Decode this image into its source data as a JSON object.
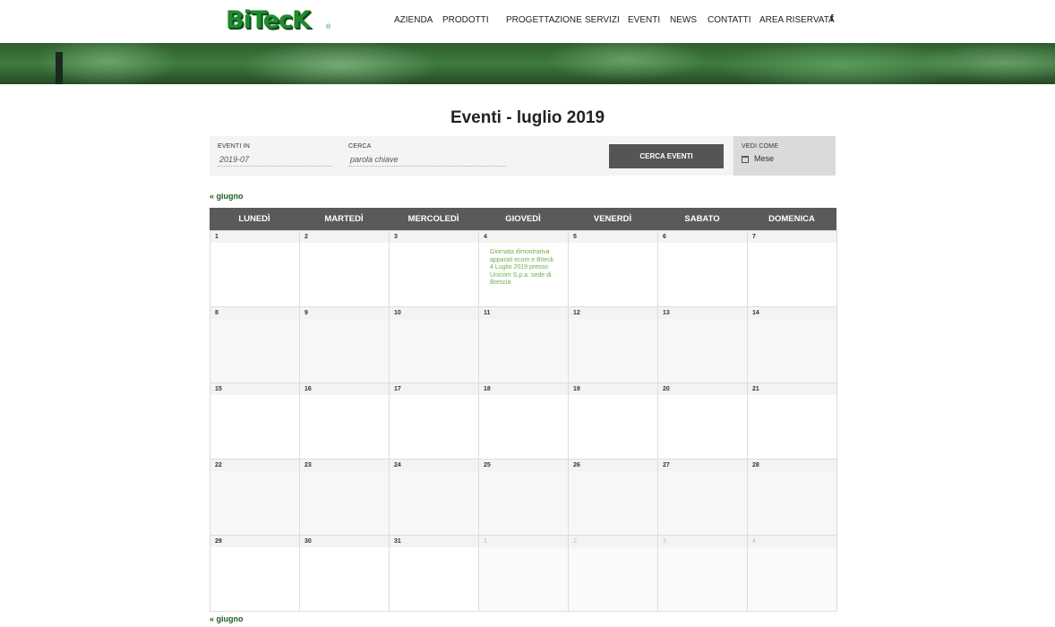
{
  "brand": {
    "logo_text": "BiTecK",
    "logo_reg": "®"
  },
  "nav": {
    "items": [
      "AZIENDA",
      "PRODOTTI",
      "PROGETTAZIONE",
      "SERVIZI",
      "EVENTI",
      "NEWS",
      "CONTATTI",
      "AREA RISERVATA"
    ],
    "social_icon": "facebook-icon"
  },
  "page": {
    "title": "Eventi - luglio 2019"
  },
  "filters": {
    "events_in_label": "EVENTI IN",
    "events_in_value": "2019-07",
    "search_label": "CERCA",
    "search_placeholder": "parola chiave",
    "search_button": "CERCA EVENTI",
    "view_label": "VEDI COME",
    "view_value": "Mese",
    "view_icon": "calendar-icon"
  },
  "pager": {
    "prev_top": "« giugno",
    "prev_bottom": "« giugno"
  },
  "calendar": {
    "weekdays": [
      "LUNEDÌ",
      "MARTEDÌ",
      "MERCOLEDÌ",
      "GIOVEDÌ",
      "VENERDÌ",
      "SABATO",
      "DOMENICA"
    ],
    "weeks": [
      [
        "1",
        "2",
        "3",
        "4",
        "5",
        "6",
        "7"
      ],
      [
        "8",
        "9",
        "10",
        "11",
        "12",
        "13",
        "14"
      ],
      [
        "15",
        "16",
        "17",
        "18",
        "19",
        "20",
        "21"
      ],
      [
        "22",
        "23",
        "24",
        "25",
        "26",
        "27",
        "28"
      ],
      [
        "29",
        "30",
        "31",
        "1",
        "2",
        "3",
        "4"
      ]
    ],
    "event": {
      "day": "4",
      "text": "Giornata dimostrativa apparati ecom e Biteck 4 Luglio 2019 presso Unicom S.p.a. sede di Brescia"
    }
  }
}
